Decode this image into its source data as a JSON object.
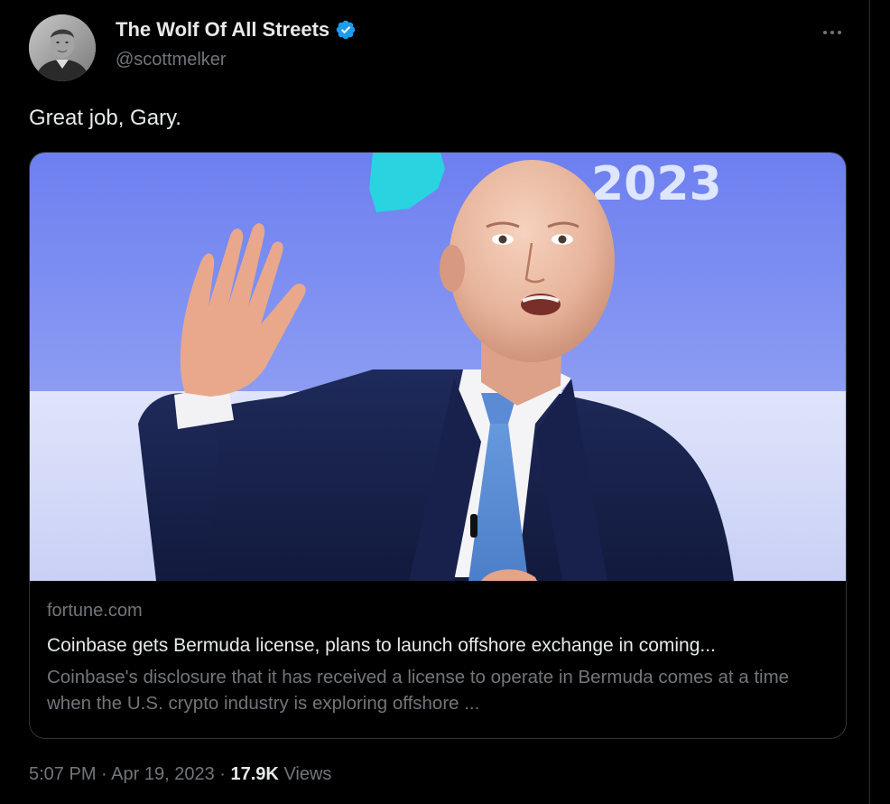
{
  "author": {
    "display_name": "The Wolf Of All Streets",
    "handle": "@scottmelker",
    "verified": true,
    "verified_color": "#1d9bf0"
  },
  "tweet": {
    "text": "Great job, Gary."
  },
  "card": {
    "image_banner_text": "2023",
    "domain": "fortune.com",
    "title": "Coinbase gets Bermuda license, plans to launch offshore exchange in coming...",
    "description": "Coinbase's disclosure that it has received a license to operate in Bermuda comes at a time when the U.S. crypto industry is exploring offshore ..."
  },
  "meta": {
    "time": "5:07 PM",
    "separator": "·",
    "date": "Apr 19, 2023",
    "views_count": "17.9K",
    "views_label": "Views"
  },
  "icons": {
    "more": "more-horizontal-icon",
    "verified": "verified-badge-icon"
  },
  "colors": {
    "background": "#000000",
    "primary_text": "#e7e9ea",
    "secondary_text": "#71767b",
    "border": "#2f3336"
  }
}
